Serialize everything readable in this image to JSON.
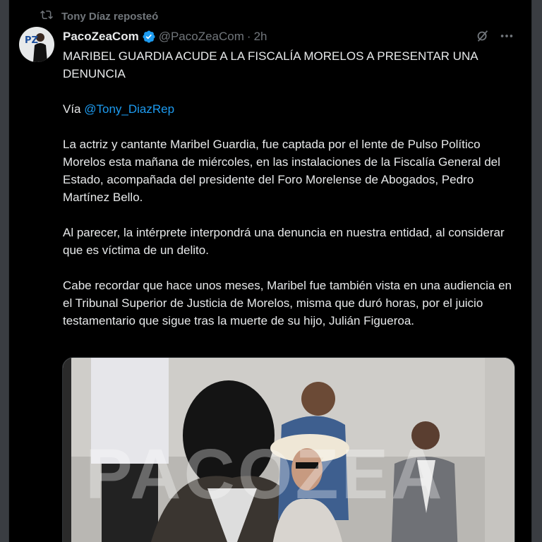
{
  "repost": {
    "label": "Tony Díaz reposteó",
    "icon": "repost-icon"
  },
  "author": {
    "name": "PacoZeaCom",
    "handle": "@PacoZeaCom",
    "time": "2h",
    "avatar_text": "PZ"
  },
  "tweet": {
    "headline": "MARIBEL GUARDIA ACUDE A LA FISCALÍA MORELOS A PRESENTAR UNA DENUNCIA",
    "via_prefix": "Vía ",
    "via_mention": "@Tony_DiazRep",
    "paragraph1": "La actriz y cantante Maribel Guardia, fue captada por el lente de Pulso Político Morelos esta mañana de miércoles, en las instalaciones de la Fiscalía General del Estado, acompañada del presidente del Foro Morelense de Abogados, Pedro Martínez Bello.",
    "paragraph2": "Al parecer, la intérprete interpondrá una denuncia en nuestra entidad, al considerar que es víctima de un delito.",
    "paragraph3": "Cabe recordar que hace unos meses, Maribel fue también vista en una audiencia en el Tribunal Superior de Justicia de Morelos, misma que duró horas, por el juicio testamentario que sigue tras la muerte de su hijo, Julián Figueroa."
  },
  "media": {
    "watermark": "PACOZEA"
  },
  "colors": {
    "background": "#000000",
    "text": "#e7e9ea",
    "muted": "#71767b",
    "link": "#1d9bf0",
    "verified": "#1d9bf0"
  }
}
